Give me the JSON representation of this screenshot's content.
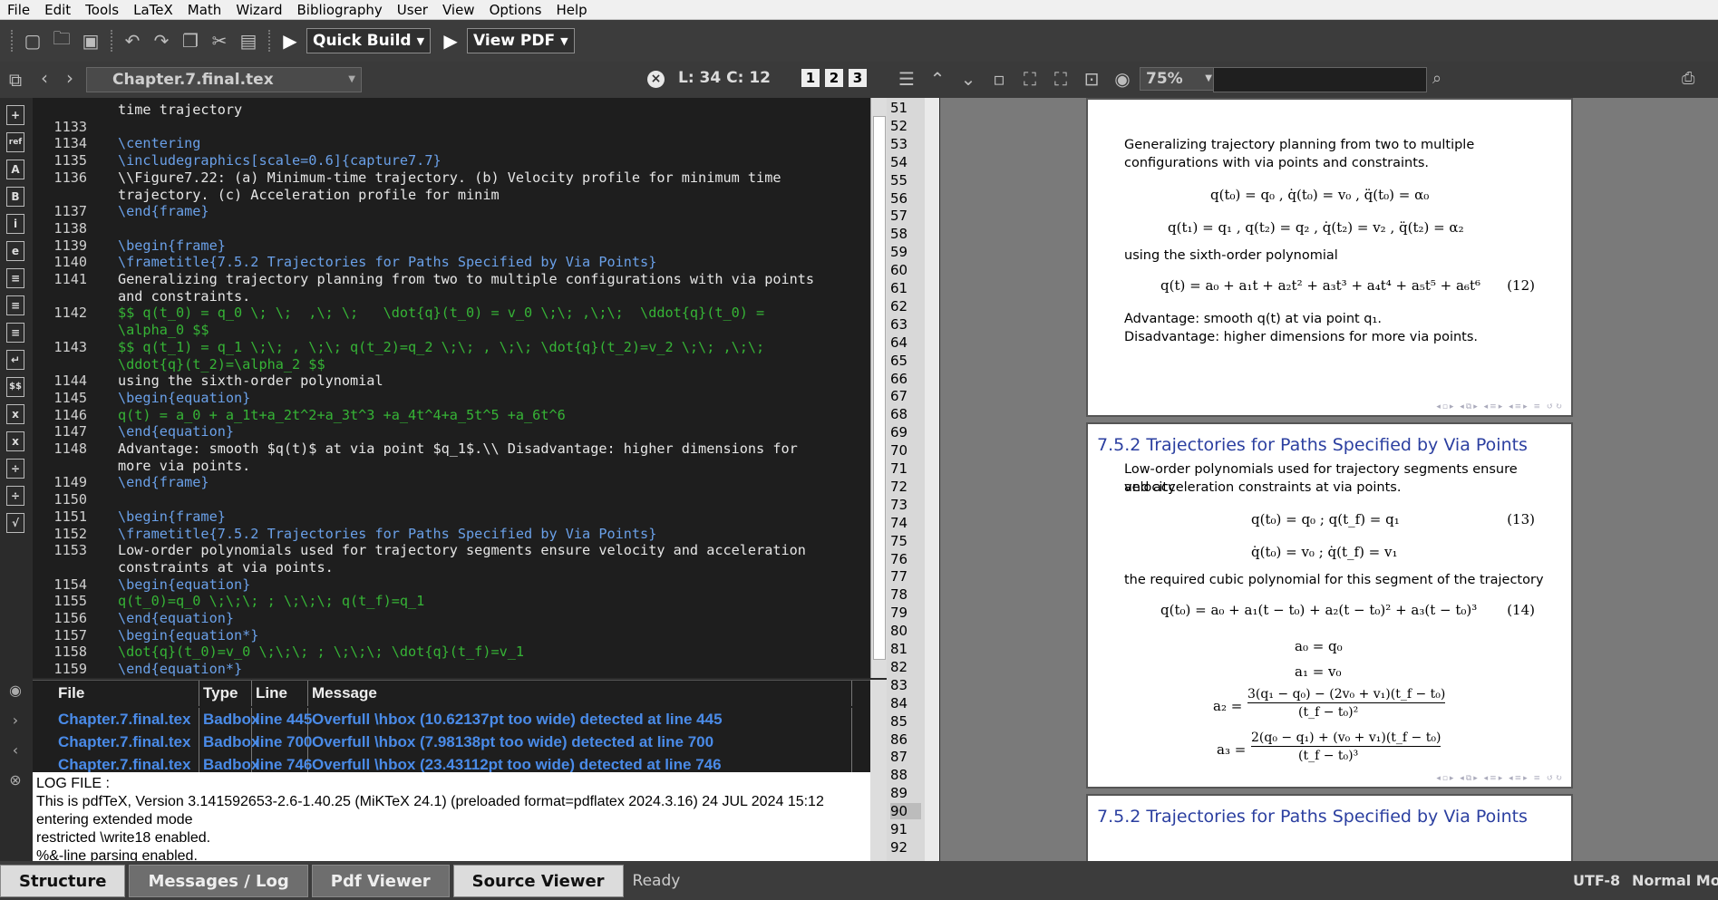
{
  "menu": [
    "File",
    "Edit",
    "Tools",
    "LaTeX",
    "Math",
    "Wizard",
    "Bibliography",
    "User",
    "View",
    "Options",
    "Help"
  ],
  "toolbar": {
    "quick_build": "Quick Build",
    "view_pdf": "View PDF"
  },
  "editor_tab": {
    "filename": "Chapter.7.final.tex",
    "cursor": "L: 34 C: 12",
    "zoom": "75%",
    "views": [
      "1",
      "2",
      "3"
    ]
  },
  "editor_lines": [
    {
      "n": "",
      "t": "time trajectory"
    },
    {
      "n": "1133",
      "t": ""
    },
    {
      "n": "1134",
      "t": "\\centering"
    },
    {
      "n": "1135",
      "t": "\\includegraphics[scale=0.6]{capture7.7}"
    },
    {
      "n": "1136",
      "t": "\\\\Figure7.22: (a) Minimum-time trajectory. (b) Velocity profile for minimum time"
    },
    {
      "n": "",
      "t": "trajectory. (c) Acceleration profile for minim"
    },
    {
      "n": "1137",
      "t": "\\end{frame}"
    },
    {
      "n": "1138",
      "t": ""
    },
    {
      "n": "1139",
      "t": "\\begin{frame}"
    },
    {
      "n": "1140",
      "t": "\\frametitle{7.5.2 Trajectories for Paths Specified by Via Points}"
    },
    {
      "n": "1141",
      "t": "Generalizing trajectory planning from two to multiple configurations with via points"
    },
    {
      "n": "",
      "t": "and constraints."
    },
    {
      "n": "1142",
      "t": "$$ q(t_0) = q_0 \\; \\;  ,\\; \\;   \\dot{q}(t_0) = v_0 \\;\\; ,\\;\\;  \\ddot{q}(t_0) ="
    },
    {
      "n": "",
      "t": "\\alpha_0 $$"
    },
    {
      "n": "1143",
      "t": "$$ q(t_1) = q_1 \\;\\; , \\;\\; q(t_2)=q_2 \\;\\; , \\;\\; \\dot{q}(t_2)=v_2 \\;\\; ,\\;\\;"
    },
    {
      "n": "",
      "t": "\\ddot{q}(t_2)=\\alpha_2 $$"
    },
    {
      "n": "1144",
      "t": "using the sixth-order polynomial"
    },
    {
      "n": "1145",
      "t": "\\begin{equation}"
    },
    {
      "n": "1146",
      "t": "q(t) = a_0 + a_1t+a_2t^2+a_3t^3 +a_4t^4+a_5t^5 +a_6t^6"
    },
    {
      "n": "1147",
      "t": "\\end{equation}"
    },
    {
      "n": "1148",
      "t": "Advantage: smooth $q(t)$ at via point $q_1$.\\\\ Disadvantage: higher dimensions for"
    },
    {
      "n": "",
      "t": "more via points."
    },
    {
      "n": "1149",
      "t": "\\end{frame}"
    },
    {
      "n": "1150",
      "t": ""
    },
    {
      "n": "1151",
      "t": "\\begin{frame}"
    },
    {
      "n": "1152",
      "t": "\\frametitle{7.5.2 Trajectories for Paths Specified by Via Points}"
    },
    {
      "n": "1153",
      "t": "Low-order polynomials used for trajectory segments ensure velocity and acceleration"
    },
    {
      "n": "",
      "t": "constraints at via points."
    },
    {
      "n": "1154",
      "t": "\\begin{equation}"
    },
    {
      "n": "1155",
      "t": "q(t_0)=q_0 \\;\\;\\; ; \\;\\;\\; q(t_f)=q_1"
    },
    {
      "n": "1156",
      "t": "\\end{equation}"
    },
    {
      "n": "1157",
      "t": "\\begin{equation*}"
    },
    {
      "n": "1158",
      "t": "\\dot{q}(t_0)=v_0 \\;\\;\\; ; \\;\\;\\; \\dot{q}(t_f)=v_1"
    },
    {
      "n": "1159",
      "t": "\\end{equation*}"
    }
  ],
  "structure_lines": [
    "51",
    "52",
    "53",
    "54",
    "55",
    "56",
    "57",
    "58",
    "59",
    "60",
    "61",
    "62",
    "63",
    "64",
    "65",
    "66",
    "67",
    "68",
    "69",
    "70",
    "71",
    "72",
    "73",
    "74",
    "75",
    "76",
    "77",
    "78",
    "79",
    "80",
    "81",
    "82",
    "83",
    "84",
    "85",
    "86",
    "87",
    "88",
    "89",
    "90",
    "91",
    "92"
  ],
  "messages": {
    "headers": [
      "File",
      "Type",
      "Line",
      "Message"
    ],
    "rows": [
      [
        "Chapter.7.final.tex",
        "Badbox",
        "line 445",
        "Overfull \\hbox (10.62137pt too wide) detected at line 445"
      ],
      [
        "Chapter.7.final.tex",
        "Badbox",
        "line 700",
        "Overfull \\hbox (7.98138pt too wide) detected at line 700"
      ],
      [
        "Chapter.7.final.tex",
        "Badbox",
        "line 746",
        "Overfull \\hbox (23.43112pt too wide) detected at line 746"
      ]
    ]
  },
  "log": [
    "LOG FILE :",
    "This is pdfTeX, Version 3.141592653-2.6-1.40.25 (MiKTeX 24.1) (preloaded format=pdflatex 2024.3.16) 24 JUL 2024 15:12",
    "entering extended mode",
    "restricted \\write18 enabled.",
    "%&-line parsing enabled."
  ],
  "pdf": {
    "page1": {
      "intro1": "Generalizing trajectory planning from two to multiple",
      "intro2": "configurations with via points and constraints.",
      "eq1": "q(t₀) = q₀  ,  q̇(t₀) = v₀  ,  q̈(t₀) = α₀",
      "eq2": "q(t₁) = q₁  ,  q(t₂) = q₂  ,  q̇(t₂) = v₂  ,  q̈(t₂) = α₂",
      "using": "using the sixth-order polynomial",
      "eq3": "q(t) = a₀ + a₁t + a₂t² + a₃t³ + a₄t⁴ + a₅t⁵ + a₆t⁶",
      "eq3num": "(12)",
      "adv": "Advantage: smooth q(t) at via point q₁.",
      "dis": "Disadvantage: higher dimensions for more via points."
    },
    "page2": {
      "title": "7.5.2 Trajectories for Paths Specified by Via Points",
      "intro1": "Low-order polynomials used for trajectory segments ensure velocity",
      "intro2": "and acceleration constraints at via points.",
      "eq1": "q(t₀) = q₀   ;   q(t_f) = q₁",
      "eq1num": "(13)",
      "eq2": "q̇(t₀) = v₀   ;   q̇(t_f) = v₁",
      "cubic": "the required cubic polynomial for this segment of the trajectory",
      "eq3": "q(t₀) = a₀ + a₁(t − t₀) + a₂(t − t₀)² + a₃(t − t₀)³",
      "eq3num": "(14)",
      "a0": "a₀ = q₀",
      "a1": "a₁ = v₀",
      "a2lhs": "a₂ =",
      "a2num": "3(q₁ − q₀) − (2v₀ + v₁)(t_f − t₀)",
      "a2den": "(t_f − t₀)²",
      "a3lhs": "a₃ =",
      "a3num": "2(q₀ − q₁) + (v₀ + v₁)(t_f − t₀)",
      "a3den": "(t_f − t₀)³"
    },
    "page3": {
      "title": "7.5.2 Trajectories for Paths Specified by Via Points"
    }
  },
  "statusbar": {
    "tabs": [
      "Structure",
      "Messages / Log",
      "Pdf Viewer",
      "Source Viewer"
    ],
    "ready": "Ready",
    "encoding": "UTF-8",
    "mode": "Normal Mode"
  }
}
